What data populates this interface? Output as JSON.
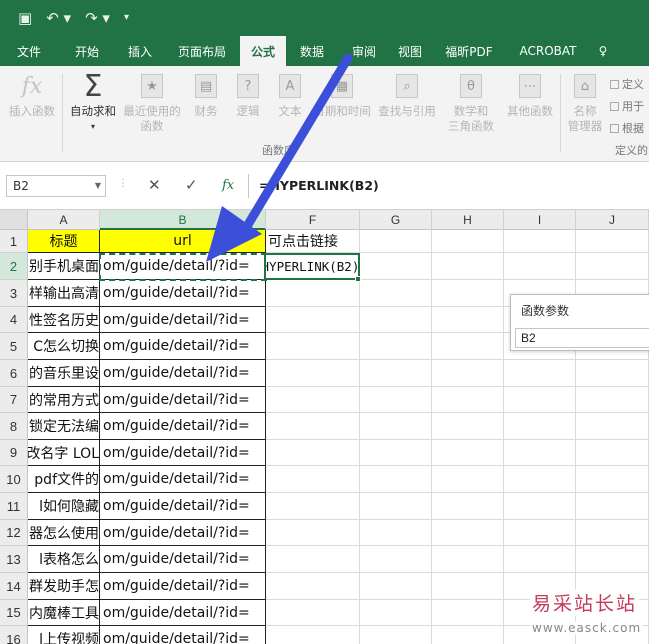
{
  "quick_access": {
    "save_icon": "save-icon",
    "undo_icon": "undo-icon",
    "redo_icon": "redo-icon",
    "customize_icon": "customize-toolbar-icon"
  },
  "tabs": [
    {
      "label": "文件"
    },
    {
      "label": "开始"
    },
    {
      "label": "插入"
    },
    {
      "label": "页面布局"
    },
    {
      "label": "公式",
      "active": true
    },
    {
      "label": "数据"
    },
    {
      "label": "审阅"
    },
    {
      "label": "视图"
    },
    {
      "label": "福昕PDF"
    },
    {
      "label": "ACROBAT"
    },
    {
      "label": "♀"
    }
  ],
  "ribbon": {
    "insert_function": {
      "line1": "插入函数",
      "icon": "fx-icon"
    },
    "autosum": {
      "line1": "自动求和",
      "line2": "▾",
      "icon": "sigma-icon"
    },
    "recent": {
      "line1": "最近使用的",
      "line2": "函数",
      "icon": "star-icon"
    },
    "financial": {
      "line1": "财务",
      "icon": "financial-icon"
    },
    "logical": {
      "line1": "逻辑",
      "icon": "question-icon"
    },
    "text": {
      "line1": "文本",
      "icon": "text-A-icon"
    },
    "datetime": {
      "line1": "日期和时间",
      "icon": "calendar-icon"
    },
    "lookup": {
      "line1": "查找与引用",
      "icon": "search-icon"
    },
    "math": {
      "line1": "数学和",
      "line2": "三角函数",
      "icon": "theta-icon"
    },
    "other": {
      "line1": "其他函数",
      "icon": "more-icon"
    },
    "name_manager": {
      "line1": "名称",
      "line2": "管理器",
      "icon": "tag-icon"
    },
    "group_label": "函数库",
    "define_name": "定义",
    "use_in_formula": "用于",
    "create_from_selection": "根据",
    "defined_names_group": "定义的"
  },
  "formula_bar": {
    "name_box": "B2",
    "cancel_icon": "✕",
    "enter_icon": "✓",
    "fx_label": "fx",
    "formula": "=HYPERLINK(B2)"
  },
  "columns": [
    "A",
    "B",
    "F",
    "G",
    "H",
    "I",
    "J"
  ],
  "rows": [
    "1",
    "2",
    "3",
    "4",
    "5",
    "6",
    "7",
    "8",
    "9",
    "10",
    "11",
    "12",
    "13",
    "14",
    "15",
    "16"
  ],
  "cells": {
    "A1": "标题",
    "B1": "url",
    "F1": "可点击链接",
    "F2": "=HYPERLINK(B2)",
    "col_A": [
      "别手机桌面",
      "样输出高清",
      "性签名历史",
      "C怎么切换",
      "的音乐里设",
      "的常用方式",
      "锁定无法编",
      "改名字 LOL",
      "pdf文件的",
      "l如何隐藏",
      "器怎么使用",
      "l表格怎么",
      "群发助手怎",
      "内魔棒工具",
      "l上传视频"
    ],
    "col_B_value": "om/guide/detail/?id="
  },
  "dialog": {
    "title": "函数参数",
    "value": "B2"
  },
  "watermark": {
    "cn": "易采站长站",
    "url": "www.easck.com"
  }
}
